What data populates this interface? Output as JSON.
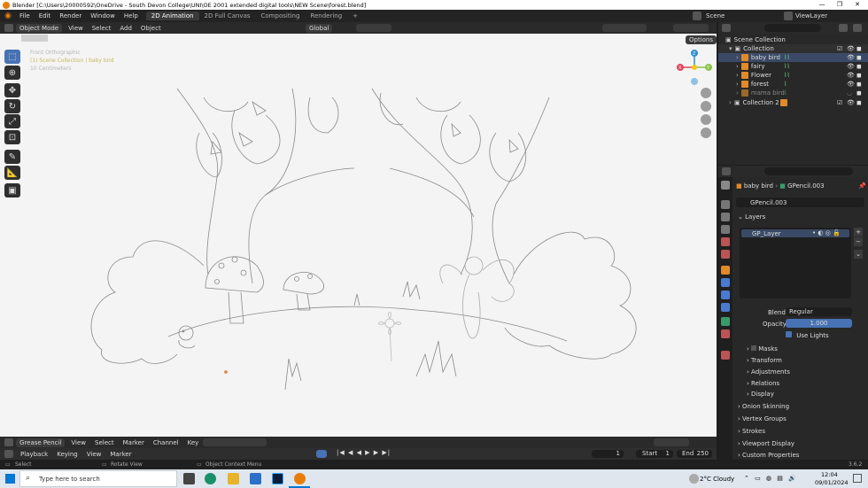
{
  "window": {
    "title": "Blender [C:\\Users\\20000592\\OneDrive - South Devon College\\UNI\\OE 2001 extended digital tools\\NEW Scene\\forest.blend]"
  },
  "menus": [
    "File",
    "Edit",
    "Render",
    "Window",
    "Help"
  ],
  "workspaces": [
    {
      "label": "2D Animation",
      "active": true
    },
    {
      "label": "2D Full Canvas",
      "active": false
    },
    {
      "label": "Compositing",
      "active": false
    },
    {
      "label": "Rendering",
      "active": false
    }
  ],
  "add_workspace": "+",
  "scene": {
    "label": "Scene",
    "view_layer": "ViewLayer"
  },
  "viewport_header": {
    "mode": "Object Mode",
    "items": [
      "View",
      "Select",
      "Add",
      "Object"
    ],
    "orientation": "Global",
    "options": "Options"
  },
  "viewport_overlay": {
    "view_name": "Front Orthographic",
    "collection": "(1) Scene Collection | baby bird",
    "units": "10 Centimeters"
  },
  "gizmo": {
    "x": "X",
    "y": "Y",
    "z": "Z"
  },
  "outliner": {
    "root": "Scene Collection",
    "collection": "Collection",
    "items": [
      {
        "label": "baby bird",
        "dim": false
      },
      {
        "label": "fairy",
        "dim": false
      },
      {
        "label": "Flower",
        "dim": false
      },
      {
        "label": "forest",
        "dim": false
      },
      {
        "label": "mama bird",
        "dim": true
      }
    ],
    "collection2": "Collection 2"
  },
  "properties": {
    "breadcrumb_object": "baby bird",
    "breadcrumb_data": "GPencil.003",
    "data_name": "GPencil.003",
    "layers_title": "Layers",
    "layer": "GP_Layer",
    "blend_label": "Blend",
    "blend_value": "Regular",
    "opacity_label": "Opacity",
    "opacity_value": "1.000",
    "use_lights": "Use Lights",
    "panels": [
      "Masks",
      "Transform",
      "Adjustments",
      "Relations",
      "Display"
    ],
    "sections": [
      "Onion Skinning",
      "Vertex Groups",
      "Strokes",
      "Viewport Display",
      "Custom Properties"
    ]
  },
  "timeline": {
    "header": [
      "Grease Pencil",
      "View",
      "Select",
      "Marker",
      "Channel",
      "Key"
    ],
    "row2": [
      "Playback",
      "Keying",
      "View",
      "Marker"
    ],
    "current_frame": "1",
    "start_label": "Start",
    "start": "1",
    "end_label": "End",
    "end": "250"
  },
  "status": {
    "select": "Select",
    "rotate": "Rotate View",
    "context": "Object Context Menu",
    "version": "3.6.2"
  },
  "taskbar": {
    "search_placeholder": "Type here to search",
    "weather": "2°C  Cloudy",
    "time": "12:04",
    "date": "09/01/2024"
  }
}
